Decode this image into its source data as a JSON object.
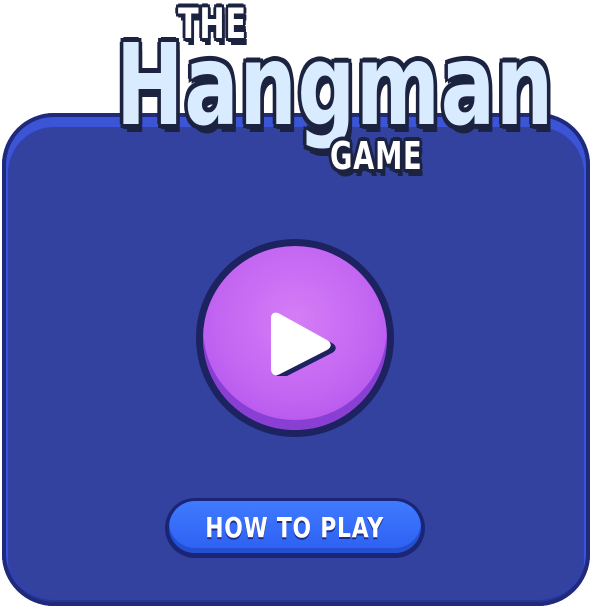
{
  "title": {
    "the": "THE",
    "main": "Hangman",
    "game": "GAME"
  },
  "play_button": {
    "icon": "play-icon"
  },
  "howto_button": {
    "label": "HOW TO PLAY"
  },
  "colors": {
    "panel": "#33429f",
    "panel_border": "#1f2a7a",
    "play_button": "#c265f2",
    "howto_button": "#3f7bff",
    "title_text": "#d9ecff",
    "outline": "#1c2340"
  }
}
